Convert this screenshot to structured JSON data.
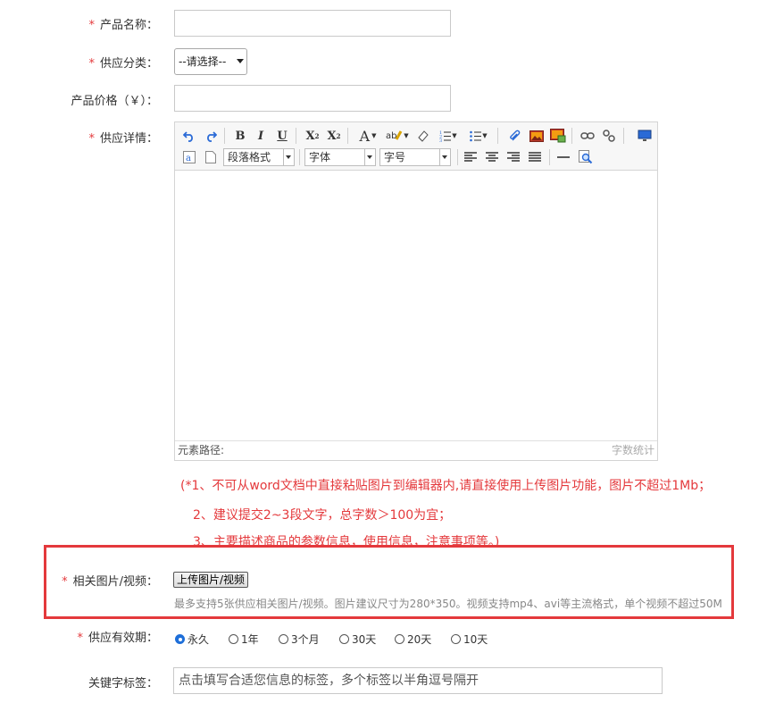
{
  "fields": {
    "product_name": {
      "label": "产品名称：",
      "required": true
    },
    "supply_category": {
      "label": "供应分类：",
      "required": true,
      "selected": "--请选择--"
    },
    "product_price": {
      "label": "产品价格（￥）：",
      "required": false
    },
    "supply_detail": {
      "label": "供应详情：",
      "required": true
    },
    "media": {
      "label": "相关图片/视频：",
      "required": true
    },
    "validity": {
      "label": "供应有效期：",
      "required": true
    },
    "keywords": {
      "label": "关键字标签：",
      "required": false
    }
  },
  "required_mark": "*",
  "editor": {
    "toolbar": {
      "paragraph_format": "段落格式",
      "font_family": "字体",
      "font_size": "字号"
    },
    "status_left": "元素路径:",
    "status_right": "字数统计"
  },
  "hints": {
    "line1": "(*1、不可从word文档中直接粘贴图片到编辑器内,请直接使用上传图片功能，图片不超过1Mb；",
    "line2": "2、建议提交2~3段文字，总字数＞100为宜；",
    "line3": "3、主要描述商品的参数信息，使用信息，注意事项等。)"
  },
  "upload": {
    "button_label": "上传图片/视频",
    "note": "最多支持5张供应相关图片/视频。图片建议尺寸为280*350。视频支持mp4、avi等主流格式，单个视频不超过50M"
  },
  "validity_options": [
    {
      "label": "永久",
      "checked": true
    },
    {
      "label": "1年",
      "checked": false
    },
    {
      "label": "3个月",
      "checked": false
    },
    {
      "label": "30天",
      "checked": false
    },
    {
      "label": "20天",
      "checked": false
    },
    {
      "label": "10天",
      "checked": false
    }
  ],
  "keywords_placeholder": "点击填写合适您信息的标签，多个标签以半角逗号隔开",
  "colors": {
    "required": "#e4393c",
    "highlight": "#e4393c",
    "radio_checked": "#1e6fd9"
  }
}
